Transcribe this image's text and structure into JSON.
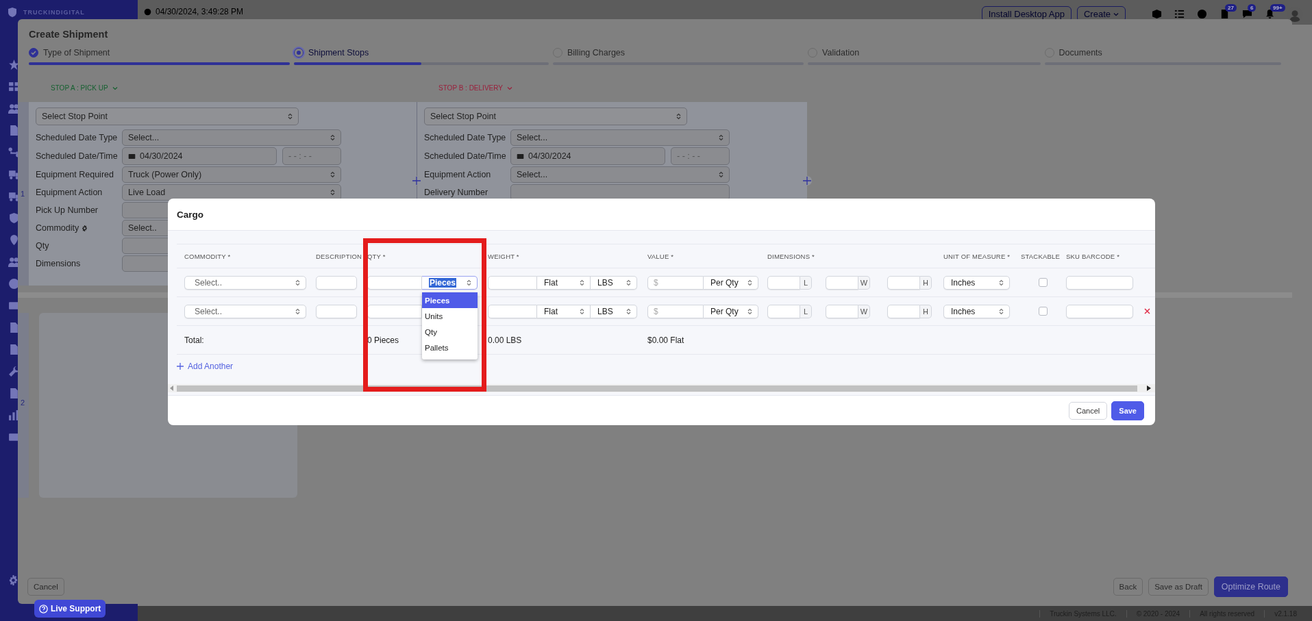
{
  "sidebar": {
    "brand": "TRUCKINDIGITAL"
  },
  "top_bar": {
    "timestamp": "04/30/2024, 3:49:28 PM",
    "buttons": [
      "Install Desktop App",
      "Create"
    ],
    "badges": [
      "27",
      "6",
      "99+"
    ]
  },
  "shipment": {
    "title": "Create Shipment",
    "steps": [
      {
        "label": "Type of Shipment",
        "completed": true,
        "selected": false,
        "level": 1
      },
      {
        "label": "Shipment Stops",
        "completed": false,
        "selected": true,
        "level": 0.5
      },
      {
        "label": "Billing Charges",
        "completed": false,
        "selected": false,
        "level": 0
      },
      {
        "label": "Validation",
        "completed": false,
        "selected": false,
        "level": 0
      },
      {
        "label": "Documents",
        "completed": false,
        "selected": false,
        "level": 0
      }
    ],
    "stops": [
      {
        "heading": "STOP A : PICK UP",
        "kind": "pickup",
        "stop_point": "Select Stop Point",
        "fields": [
          {
            "label": "Scheduled Date Type",
            "kind": "select",
            "value": "Select..."
          },
          {
            "label": "Scheduled Date/Time",
            "kind": "datetime",
            "value": "04/30/2024",
            "time": "- -  :  - -"
          },
          {
            "label": "Equipment Required",
            "kind": "select",
            "value": "Truck (Power Only)"
          },
          {
            "label": "Equipment Action",
            "kind": "select",
            "value": "Live Load"
          },
          {
            "label": "Pick Up Number",
            "kind": "input"
          },
          {
            "label": "Commodity",
            "kind": "select",
            "value": "Select..",
            "gear": true
          },
          {
            "label": "Qty",
            "kind": "input"
          },
          {
            "label": "Dimensions",
            "kind": "input"
          }
        ]
      },
      {
        "heading": "STOP B : DELIVERY",
        "kind": "delivery",
        "stop_point": "Select Stop Point",
        "fields": [
          {
            "label": "Scheduled Date Type",
            "kind": "select",
            "value": "Select..."
          },
          {
            "label": "Scheduled Date/Time",
            "kind": "datetime",
            "value": "04/30/2024",
            "time": "- -  :  - -"
          },
          {
            "label": "Equipment Action",
            "kind": "select",
            "value": "Select..."
          },
          {
            "label": "Delivery Number",
            "kind": "input"
          }
        ]
      }
    ],
    "row_numbers": [
      "1",
      "2"
    ],
    "footer": {
      "cancel": "Cancel",
      "buttons": [
        "Back",
        "Save as Draft",
        "Optimize Route"
      ]
    }
  },
  "cargo": {
    "title": "Cargo",
    "columns": [
      "COMMODITY *",
      "DESCRIPTION",
      "QTY *",
      "WEIGHT *",
      "VALUE *",
      "DIMENSIONS *",
      "UNIT OF MEASURE *",
      "STACKABLE",
      "SKU BARCODE *"
    ],
    "rows": [
      {
        "commodity": "Select..",
        "qty_unit": "Pieces",
        "focused": true,
        "weight_basis": "Flat",
        "weight_unit": "LBS",
        "value_placeholder": "$",
        "value_basis": "Per Qty",
        "dimension_units": [
          "L",
          "W",
          "H"
        ],
        "unit_of_measure": "Inches",
        "stackable": false,
        "removable": false
      },
      {
        "commodity": "Select..",
        "weight_basis": "Flat",
        "weight_unit": "LBS",
        "value_placeholder": "$",
        "value_basis": "Per Qty",
        "dimension_units": [
          "L",
          "W",
          "H"
        ],
        "unit_of_measure": "Inches",
        "stackable": false,
        "removable": true
      }
    ],
    "totals": {
      "label": "Total:",
      "qty": "0 Pieces",
      "weight": "0.00 LBS",
      "value": "$0.00 Flat"
    },
    "add_another": "Add Another",
    "dropdown": [
      {
        "label": "Pieces",
        "selected": true
      },
      {
        "label": "Units",
        "selected": false
      },
      {
        "label": "Qty",
        "selected": false
      },
      {
        "label": "Pallets",
        "selected": false
      }
    ],
    "buttons": [
      "Cancel",
      "Save"
    ]
  },
  "live_support": "Live Support",
  "status_bar": [
    "Truckin Systems LLC.",
    "© 2020 - 2024",
    "All rights reserved",
    "v2.1.18"
  ]
}
